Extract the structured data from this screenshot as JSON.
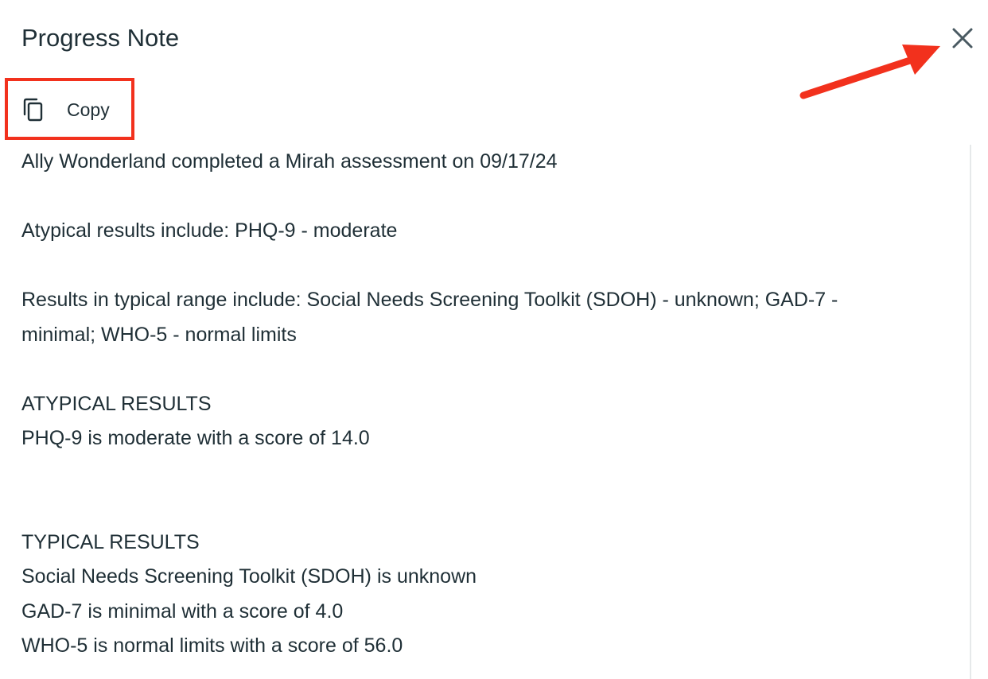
{
  "dialog": {
    "title": "Progress Note",
    "copy_label": "Copy",
    "icons": {
      "close": "close-icon",
      "copy": "copy-icon"
    }
  },
  "annotations": {
    "highlight_color": "#f2311d",
    "arrow_color": "#f2311d"
  },
  "note": {
    "summary": "Ally Wonderland completed a Mirah assessment on 09/17/24",
    "atypical_summary": "Atypical results include: PHQ-9 - moderate",
    "typical_summary": "Results in typical range include: Social Needs Screening Toolkit (SDOH) - unknown; GAD-7 - minimal; WHO-5 - normal limits",
    "atypical_heading": "ATYPICAL RESULTS",
    "atypical_items": [
      "PHQ-9 is moderate with a score of 14.0"
    ],
    "typical_heading": "TYPICAL RESULTS",
    "typical_items": [
      "Social Needs Screening Toolkit (SDOH) is unknown",
      "GAD-7 is minimal with a score of 4.0",
      "WHO-5 is normal limits with a score of 56.0"
    ]
  },
  "colors": {
    "text": "#1f2f36",
    "icon": "#4a5a62",
    "background": "#ffffff"
  }
}
